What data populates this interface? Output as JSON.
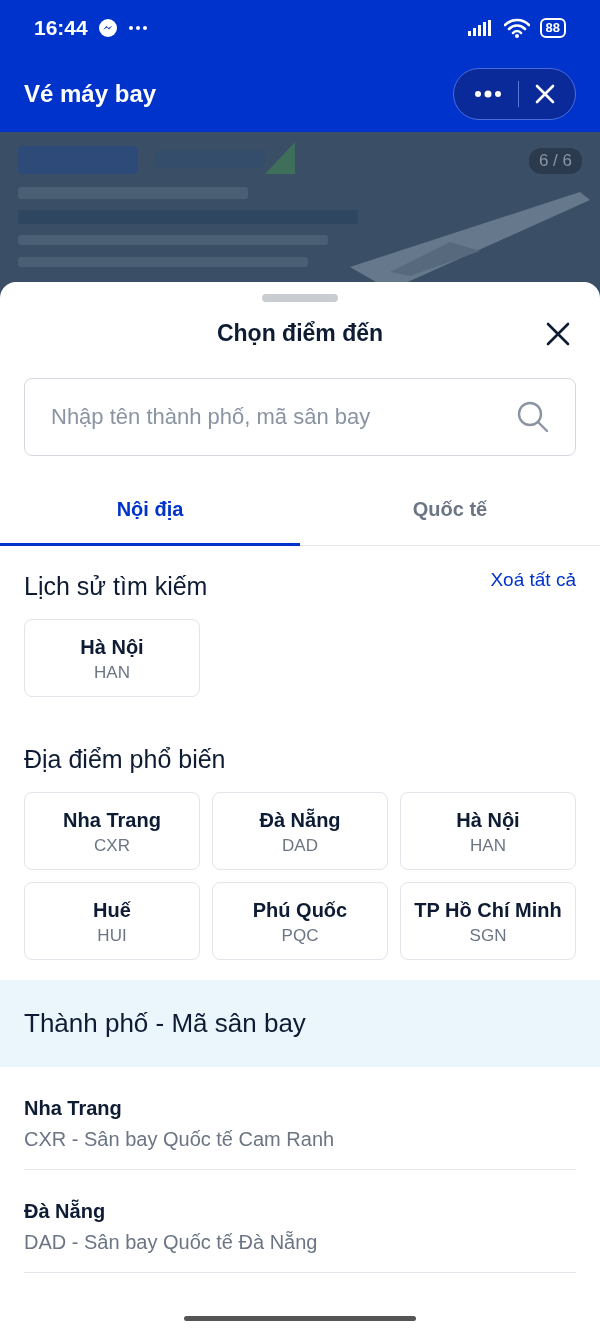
{
  "status_bar": {
    "time": "16:44",
    "battery": "88"
  },
  "header": {
    "title": "Vé máy bay"
  },
  "banner": {
    "kind": "picture",
    "counter": "6 / 6"
  },
  "sheet": {
    "title": "Chọn điểm đến",
    "search": {
      "placeholder": "Nhập tên thành phố, mã sân bay"
    },
    "tabs": [
      {
        "label": "Nội địa",
        "selected": true
      },
      {
        "label": "Quốc tế",
        "selected": false
      }
    ],
    "history": {
      "title": "Lịch sử tìm kiếm",
      "clear": "Xoá tất cả",
      "items": [
        {
          "city": "Hà Nội",
          "code": "HAN"
        }
      ]
    },
    "popular": {
      "title": "Địa điểm phổ biến",
      "items": [
        {
          "city": "Nha Trang",
          "code": "CXR"
        },
        {
          "city": "Đà Nẵng",
          "code": "DAD"
        },
        {
          "city": "Hà Nội",
          "code": "HAN"
        },
        {
          "city": "Huế",
          "code": "HUI"
        },
        {
          "city": "Phú Quốc",
          "code": "PQC"
        },
        {
          "city": "TP Hồ Chí Minh",
          "code": "SGN"
        }
      ]
    },
    "list": {
      "title": "Thành phố - Mã sân bay",
      "items": [
        {
          "city": "Nha Trang",
          "airport": "CXR - Sân bay Quốc tế Cam Ranh"
        },
        {
          "city": "Đà Nẵng",
          "airport": "DAD - Sân bay Quốc tế Đà Nẵng"
        }
      ]
    }
  }
}
